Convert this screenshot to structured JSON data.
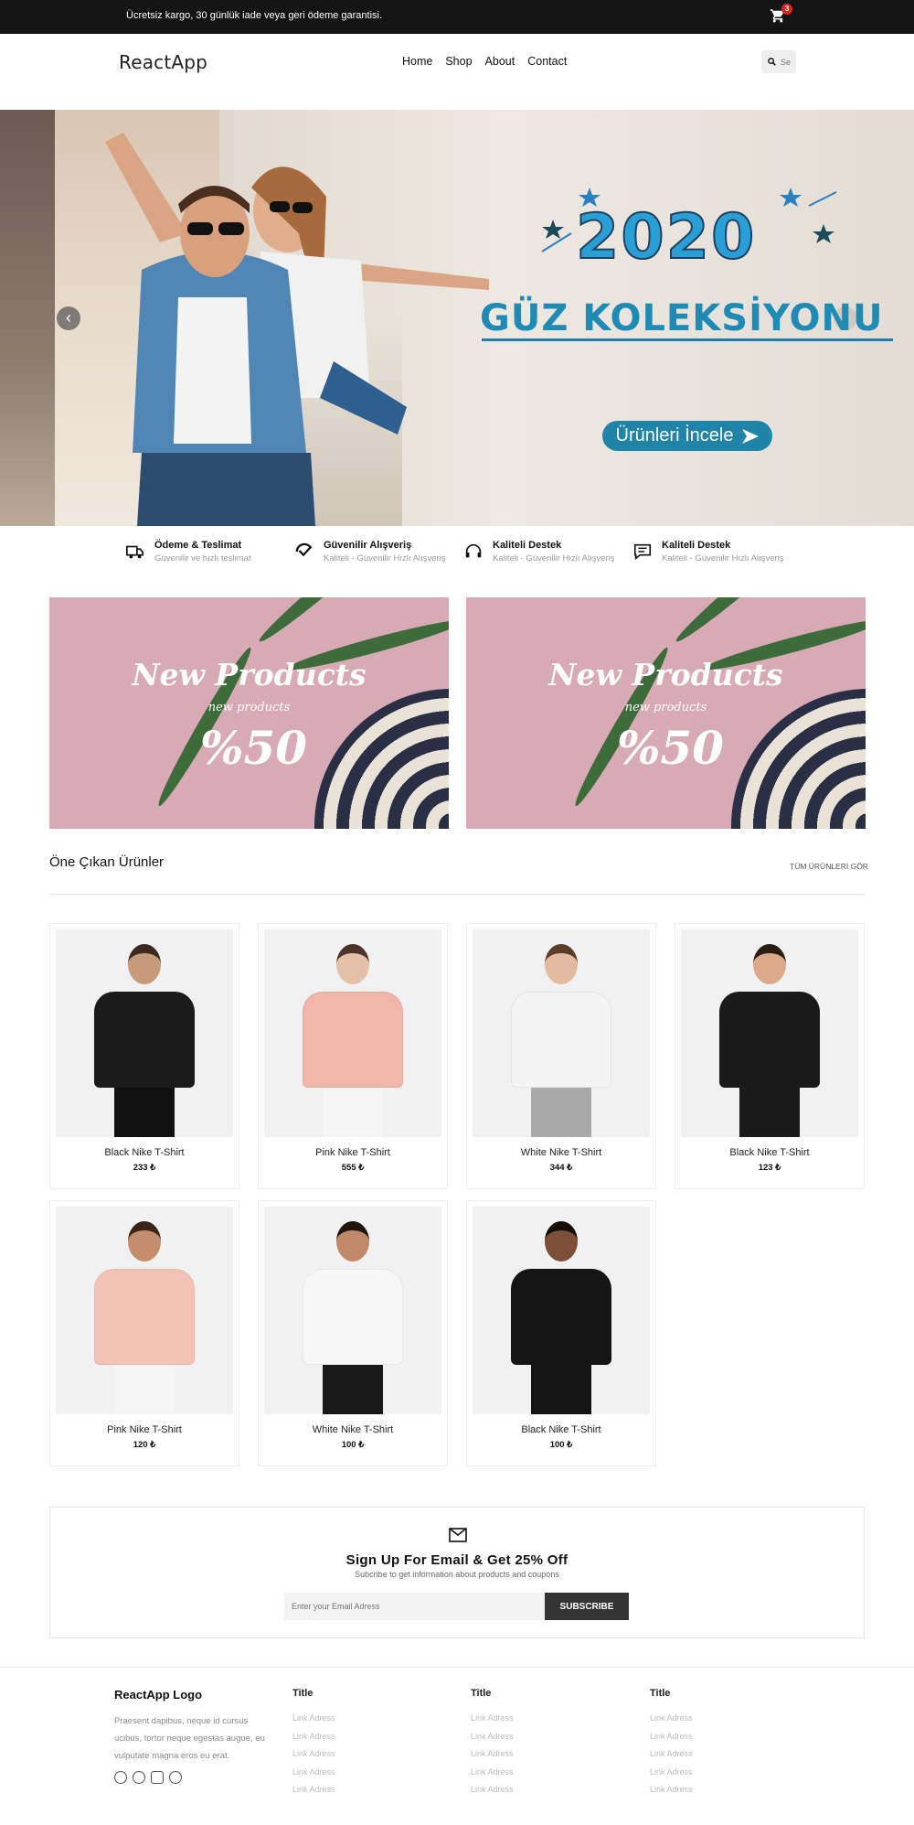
{
  "topbar": {
    "message": "Ücretsiz kargo, 30 günlük iade veya geri ödeme garantisi.",
    "cart_count": "3"
  },
  "header": {
    "logo": "ReactApp",
    "nav": [
      "Home",
      "Shop",
      "About",
      "Contact"
    ],
    "search_placeholder": "Se"
  },
  "hero": {
    "year": "2020",
    "title": "GÜZ KOLEKSİYONU",
    "cta": "Ürünleri İncele"
  },
  "features": [
    {
      "title": "Ödeme & Teslimat",
      "desc": "Güvenilir ve hızlı teslimat",
      "icon": "truck-icon"
    },
    {
      "title": "Güvenilir Alışveriş",
      "desc": "Kaliteli - Güvenilir Hızlı Alışveriş",
      "icon": "badge-check-icon"
    },
    {
      "title": "Kaliteli Destek",
      "desc": "Kaliteli - Güvenilir Hızlı Alışveriş",
      "icon": "headset-icon"
    },
    {
      "title": "Kaliteli Destek",
      "desc": "Kaliteli - Güvenilir Hızlı Alışveriş",
      "icon": "chat-icon"
    }
  ],
  "banners": [
    {
      "title": "New Products",
      "subtitle": "new products",
      "discount": "%50"
    },
    {
      "title": "New Products",
      "subtitle": "new products",
      "discount": "%50"
    }
  ],
  "featured": {
    "title": "Öne Çıkan Ürünler",
    "link": "TÜM ÜRÜNLERİ GÖR",
    "products": [
      {
        "name": "Black Nike T-Shirt",
        "price": "233 ₺",
        "shirt": "#1b1b1b",
        "legs": "#111111",
        "skin": "#c79a7c",
        "hair": "#3a2a20"
      },
      {
        "name": "Pink Nike T-Shirt",
        "price": "555 ₺",
        "shirt": "#f1b6aa",
        "legs": "#f5f5f5",
        "skin": "#e5c0a8",
        "hair": "#4b3325"
      },
      {
        "name": "White Nike T-Shirt",
        "price": "344 ₺",
        "shirt": "#f4f4f4",
        "legs": "#a9a9a9",
        "skin": "#e2bba0",
        "hair": "#5a3d2a"
      },
      {
        "name": "Black Nike T-Shirt",
        "price": "123 ₺",
        "shirt": "#1a1a1a",
        "legs": "#1a1a1a",
        "skin": "#d9a98a",
        "hair": "#2c1d14"
      },
      {
        "name": "Pink Nike T-Shirt",
        "price": "120 ₺",
        "shirt": "#f3c3b8",
        "legs": "#f5f5f5",
        "skin": "#c48d6e",
        "hair": "#3b2418"
      },
      {
        "name": "White Nike T-Shirt",
        "price": "100 ₺",
        "shirt": "#f7f7f7",
        "legs": "#181818",
        "skin": "#c08a6a",
        "hair": "#20150f"
      },
      {
        "name": "Black Nike T-Shirt",
        "price": "100 ₺",
        "shirt": "#151515",
        "legs": "#151515",
        "skin": "#7b4f38",
        "hair": "#140e0a"
      }
    ]
  },
  "newsletter": {
    "title": "Sign Up For Email & Get 25% Off",
    "subtitle": "Subcribe to get information about products and coupons",
    "placeholder": "Enter your Email Adress",
    "button": "SUBSCRIBE"
  },
  "footer": {
    "logo": "ReactApp Logo",
    "desc": "Praesent dapibus, neque id cursus ucibus, tortor neque egestas augue, eu vulputate magna eros eu erat.",
    "social": [
      "facebook-icon",
      "telegram-icon",
      "instagram-icon",
      "pinterest-icon"
    ],
    "columns": [
      {
        "title": "Title",
        "links": [
          "Link Adress",
          "Link Adress",
          "Link Adress",
          "Link Adress",
          "Link Adress"
        ]
      },
      {
        "title": "Title",
        "links": [
          "Link Adress",
          "Link Adress",
          "Link Adress",
          "Link Adress",
          "Link Adress"
        ]
      },
      {
        "title": "Title",
        "links": [
          "Link Adress",
          "Link Adress",
          "Link Adress",
          "Link Adress",
          "Link Adress"
        ]
      }
    ]
  }
}
